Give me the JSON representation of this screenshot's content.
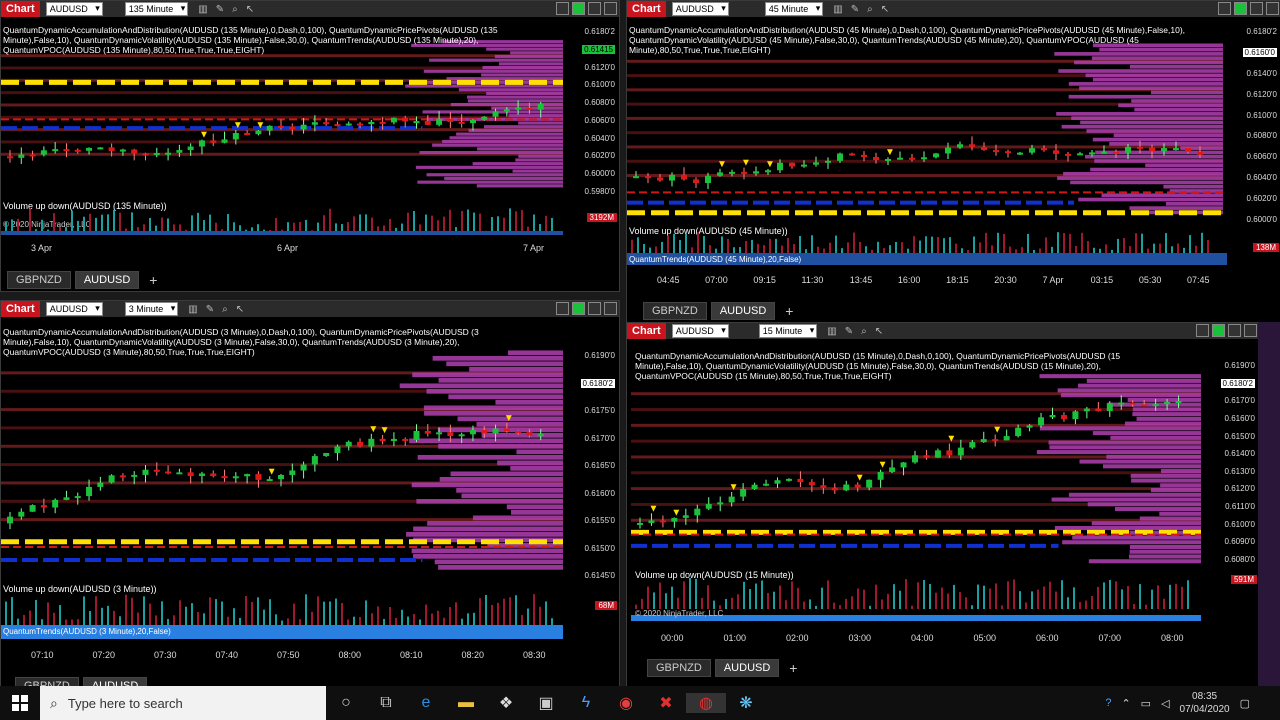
{
  "charts": [
    {
      "label": "Chart",
      "instrument": "AUDUSD",
      "interval": "135 Minute",
      "indicators": "QuantumDynamicAccumulationAndDistribution(AUDUSD (135 Minute),0,Dash,0,100), QuantumDynamicPricePivots(AUDUSD (135 Minute),False,10), QuantumDynamicVolatility(AUDUSD (135 Minute),False,30,0), QuantumTrends(AUDUSD (135 Minute),20), QuantumVPOC(AUDUSD (135 Minute),80,50,True,True,True,EIGHT)",
      "price_axis": [
        "0.6180'2",
        "0.61415",
        "0.6120'0",
        "0.6100'0",
        "0.6080'0",
        "0.6060'0",
        "0.6040'0",
        "0.6020'0",
        "0.6000'0",
        "0.5980'0"
      ],
      "volume_label": "Volume up down(AUDUSD (135 Minute))",
      "volume_tag": "3192M",
      "copyright": "© 2020 NinjaTrader, LLC",
      "time_axis": [
        "3 Apr",
        "6 Apr",
        "7 Apr"
      ],
      "tabs": [
        "GBPNZD",
        "AUDUSD"
      ],
      "active_tab": "AUDUSD"
    },
    {
      "label": "Chart",
      "instrument": "AUDUSD",
      "interval": "45 Minute",
      "indicators": "QuantumDynamicAccumulationAndDistribution(AUDUSD (45 Minute),0,Dash,0,100), QuantumDynamicPricePivots(AUDUSD (45 Minute),False,10), QuantumDynamicVolatility(AUDUSD (45 Minute),False,30,0), QuantumTrends(AUDUSD (45 Minute),20), QuantumVPOC(AUDUSD (45 Minute),80,50,True,True,True,EIGHT)",
      "price_axis": [
        "0.6180'2",
        "0.6160'0",
        "0.6140'0",
        "0.6120'0",
        "0.6100'0",
        "0.6080'0",
        "0.6060'0",
        "0.6040'0",
        "0.6020'0",
        "0.6000'0"
      ],
      "volume_label": "Volume up down(AUDUSD (45 Minute))",
      "volume_tag": "138M",
      "copyright": "QuantumTrends(AUDUSD (45 Minute),20,False)",
      "time_axis": [
        "04:45",
        "07:00",
        "09:15",
        "11:30",
        "13:45",
        "16:00",
        "18:15",
        "20:30",
        "7 Apr",
        "03:15",
        "05:30",
        "07:45"
      ],
      "tabs": [
        "GBPNZD",
        "AUDUSD"
      ],
      "active_tab": "AUDUSD"
    },
    {
      "label": "Chart",
      "instrument": "AUDUSD",
      "interval": "3 Minute",
      "indicators": "QuantumDynamicAccumulationAndDistribution(AUDUSD (3 Minute),0,Dash,0,100), QuantumDynamicPricePivots(AUDUSD (3 Minute),False,10), QuantumDynamicVolatility(AUDUSD (3 Minute),False,30,0), QuantumTrends(AUDUSD (3 Minute),20), QuantumVPOC(AUDUSD (3 Minute),80,50,True,True,True,EIGHT)",
      "price_axis": [
        "0.6190'0",
        "0.6180'2",
        "0.6175'0",
        "0.6170'0",
        "0.6165'0",
        "0.6160'0",
        "0.6155'0",
        "0.6150'0",
        "0.6145'0"
      ],
      "volume_label": "Volume up down(AUDUSD (3 Minute))",
      "volume_tag": "68M",
      "copyright": "QuantumTrends(AUDUSD (3 Minute),20,False)",
      "time_axis": [
        "07:10",
        "07:20",
        "07:30",
        "07:40",
        "07:50",
        "08:00",
        "08:10",
        "08:20",
        "08:30"
      ],
      "tabs": [
        "GBPNZD",
        "AUDUSD"
      ],
      "active_tab": "AUDUSD"
    },
    {
      "label": "Chart",
      "instrument": "AUDUSD",
      "interval": "15 Minute",
      "indicators": "QuantumDynamicAccumulationAndDistribution(AUDUSD (15 Minute),0,Dash,0,100), QuantumDynamicPricePivots(AUDUSD (15 Minute),False,10), QuantumDynamicVolatility(AUDUSD (15 Minute),False,30,0), QuantumTrends(AUDUSD (15 Minute),20), QuantumVPOC(AUDUSD (15 Minute),80,50,True,True,True,EIGHT)",
      "price_axis": [
        "0.6190'0",
        "0.6180'2",
        "0.6170'0",
        "0.6160'0",
        "0.6150'0",
        "0.6140'0",
        "0.6130'0",
        "0.6120'0",
        "0.6110'0",
        "0.6100'0",
        "0.6090'0",
        "0.6080'0"
      ],
      "volume_label": "Volume up down(AUDUSD (15 Minute))",
      "volume_tag": "591M",
      "copyright": "© 2020 NinjaTrader, LLC",
      "time_axis": [
        "00:00",
        "01:00",
        "02:00",
        "03:00",
        "04:00",
        "05:00",
        "06:00",
        "07:00",
        "08:00"
      ],
      "tabs": [
        "GBPNZD",
        "AUDUSD"
      ],
      "active_tab": "AUDUSD"
    }
  ],
  "taskbar": {
    "search_placeholder": "Type here to search",
    "time": "08:35",
    "date": "07/04/2020"
  },
  "colors": {
    "bull": "#19c23a",
    "bear": "#e01818",
    "vpoc": "#c040c0",
    "yellow": "#ffe000"
  }
}
